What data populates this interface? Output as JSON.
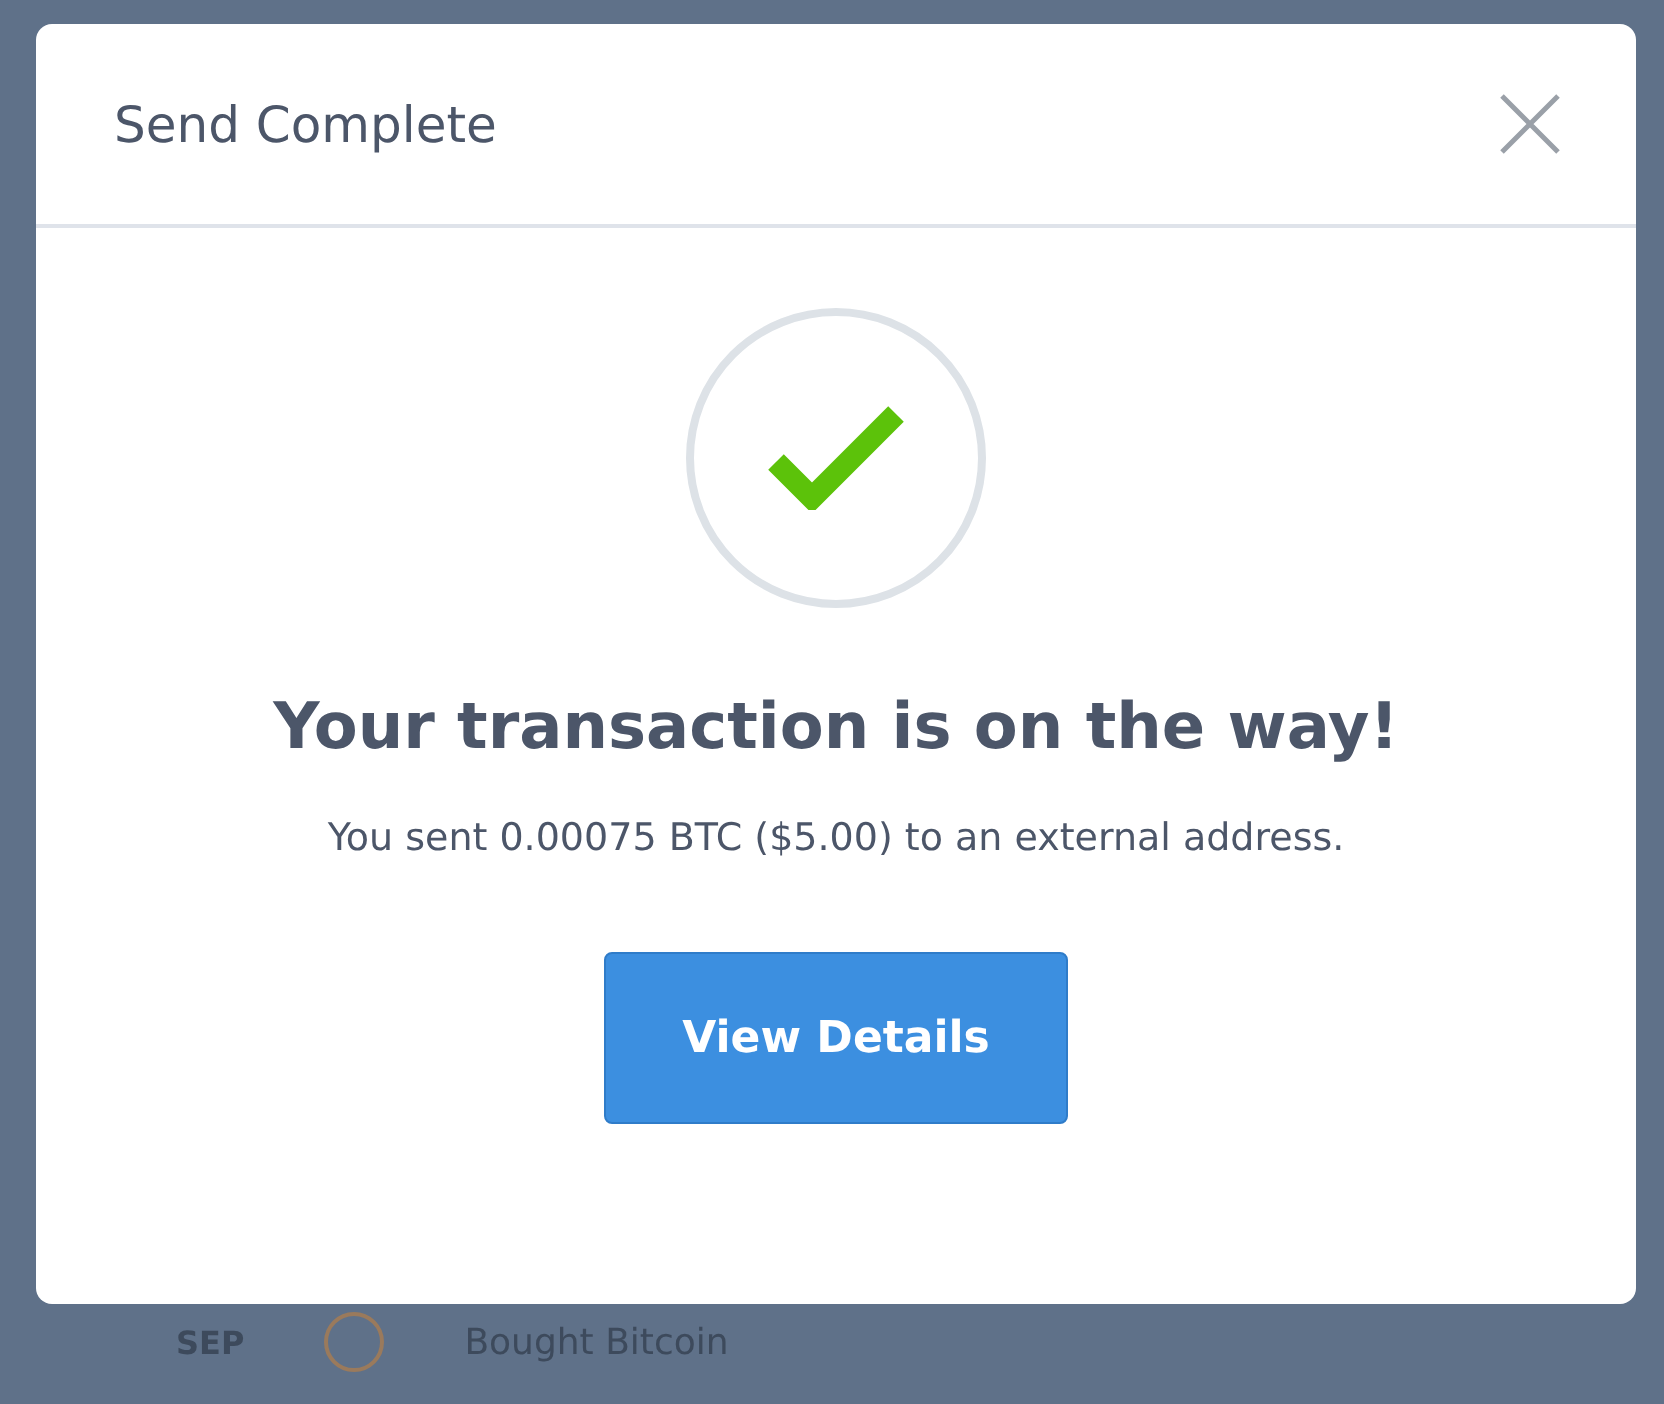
{
  "dialog": {
    "title": "Send Complete",
    "heading": "Your transaction is on the way!",
    "message": "You sent 0.00075 BTC ($5.00) to an external address.",
    "button": "View Details"
  },
  "background_row": {
    "date": "SEP",
    "description": "Bought Bitcoin"
  }
}
